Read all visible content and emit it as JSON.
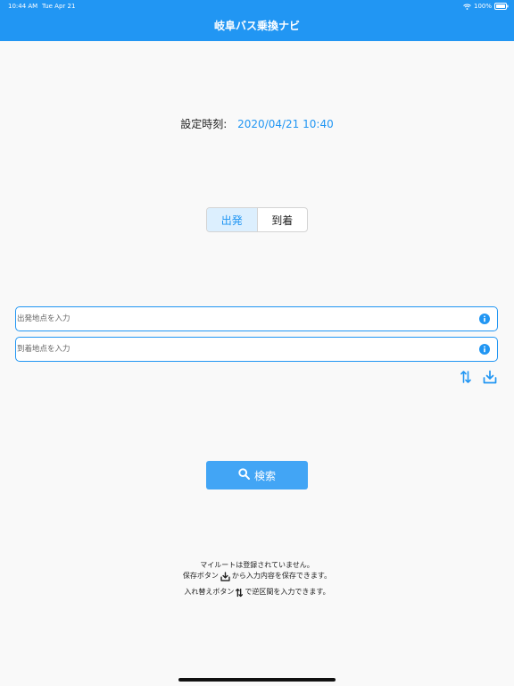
{
  "status_bar": {
    "time": "10:44 AM",
    "date": "Tue Apr 21",
    "battery": "100%"
  },
  "header": {
    "title": "岐阜バス乗換ナビ"
  },
  "time_setting": {
    "label": "設定時刻:",
    "value": "2020/04/21 10:40"
  },
  "mode_toggle": {
    "options": [
      "出発",
      "到着"
    ],
    "selected": "出発"
  },
  "inputs": {
    "departure_placeholder": "出発地点を入力",
    "arrival_placeholder": "到着地点を入力"
  },
  "search": {
    "label": "検索"
  },
  "notes": {
    "line1": "マイルートは登録されていません。",
    "line2_before": "保存ボタン",
    "line2_after": "から入力内容を保存できます。",
    "line3_before": "入れ替えボタン",
    "line3_after": "で逆区間を入力できます。"
  },
  "colors": {
    "accent": "#2196f3",
    "button": "#42a5f5",
    "segment_active_bg": "#dceffe"
  },
  "icons": [
    "wifi-icon",
    "battery-icon",
    "info-icon",
    "swap-icon",
    "save-icon",
    "search-icon"
  ]
}
